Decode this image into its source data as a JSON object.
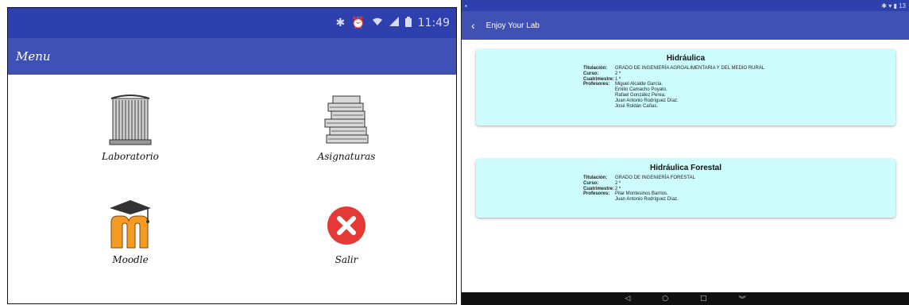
{
  "left": {
    "status": {
      "icons": [
        "bluetooth-icon",
        "alarm-icon",
        "wifi-icon",
        "signal-icon",
        "battery-icon"
      ],
      "time": "11:49"
    },
    "title": "Menu",
    "tiles": [
      {
        "label": "Laboratorio"
      },
      {
        "label": "Asignaturas"
      },
      {
        "label": "Moodle"
      },
      {
        "label": "Salir"
      }
    ]
  },
  "right": {
    "status": {
      "time": "13"
    },
    "title": "Enjoy Your Lab",
    "cards": [
      {
        "title": "Hidráulica",
        "titulacion_label": "Titulación:",
        "titulacion": "GRADO DE INGENIERÍA AGROALIMENTARIA Y DEL MEDIO RURAL",
        "curso_label": "Curso:",
        "curso": "2 º",
        "cuatrimestre_label": "Cuatrimestre:",
        "cuatrimestre": "1 º",
        "profesores_label": "Profesores:",
        "profesores": [
          "Miguel Alcalde García.",
          "Emilio Camacho Poyato.",
          "Rafael González Perea.",
          "Juan Antonio Rodríguez Díaz.",
          "José Roldán Cañas."
        ]
      },
      {
        "title": "Hidráulica Forestal",
        "titulacion_label": "Titulación:",
        "titulacion": "GRADO DE INGENIERÍA FORESTAL",
        "curso_label": "Curso:",
        "curso": "2 º",
        "cuatrimestre_label": "Cuatrimestre:",
        "cuatrimestre": "2 º",
        "profesores_label": "Profesores:",
        "profesores": [
          "Pilar Montesinos Barrios.",
          "Juan Antonio Rodríguez Díaz."
        ]
      }
    ],
    "nav": {
      "back": "◁",
      "home": "○",
      "recents": "□",
      "collapse": "︾"
    }
  },
  "colors": {
    "primary": "#3f51b5",
    "primary_dark": "#2d40ad",
    "card_bg": "#ccfcfc",
    "exit_red": "#e53935"
  }
}
